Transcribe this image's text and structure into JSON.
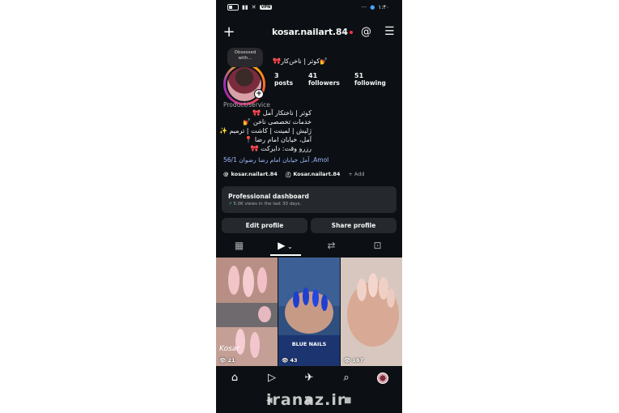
{
  "status_bar": {
    "time": "۱:۴۰",
    "vpn": "VPN",
    "dots": "···"
  },
  "header": {
    "username": "kosar.nailart.84"
  },
  "profile": {
    "note": "Obsessed with...",
    "display_name": "🎀کوثر | ناخن‌کار💅",
    "stats": [
      {
        "num": "3",
        "label": "posts"
      },
      {
        "num": "41",
        "label": "followers"
      },
      {
        "num": "51",
        "label": "following"
      }
    ],
    "category": "Product/service",
    "bio": [
      "کوثر | ناختکار آمل 🎀",
      "خدمات تخصصی ناخن 💅",
      "ژلیش | لمینت | کاشت | ترمیم ✨",
      "آمل، خیابان امام رضا 📍",
      "رزرو وقت: دایرکت 🎀"
    ],
    "location": "آمل خیابان امام رضا رضوان 56/1 ,Amol",
    "links": [
      "kosar.nailart.84",
      "Kosar.nailart.84"
    ],
    "add_link": "+ Add"
  },
  "dashboard": {
    "title": "Professional dashboard",
    "subtitle": "5.0K views in the last 30 days."
  },
  "buttons": {
    "edit": "Edit profile",
    "share": "Share profile"
  },
  "grid": [
    {
      "views": "21",
      "caption": "Kosar"
    },
    {
      "views": "43",
      "caption": "BLUE NAILS"
    },
    {
      "views": "167",
      "caption": ""
    }
  ],
  "watermark": "iranaz.ir",
  "colors": {
    "background": "#0c1014",
    "surface": "#25292e",
    "link": "#a0b8ff",
    "notification": "#ff3040"
  }
}
